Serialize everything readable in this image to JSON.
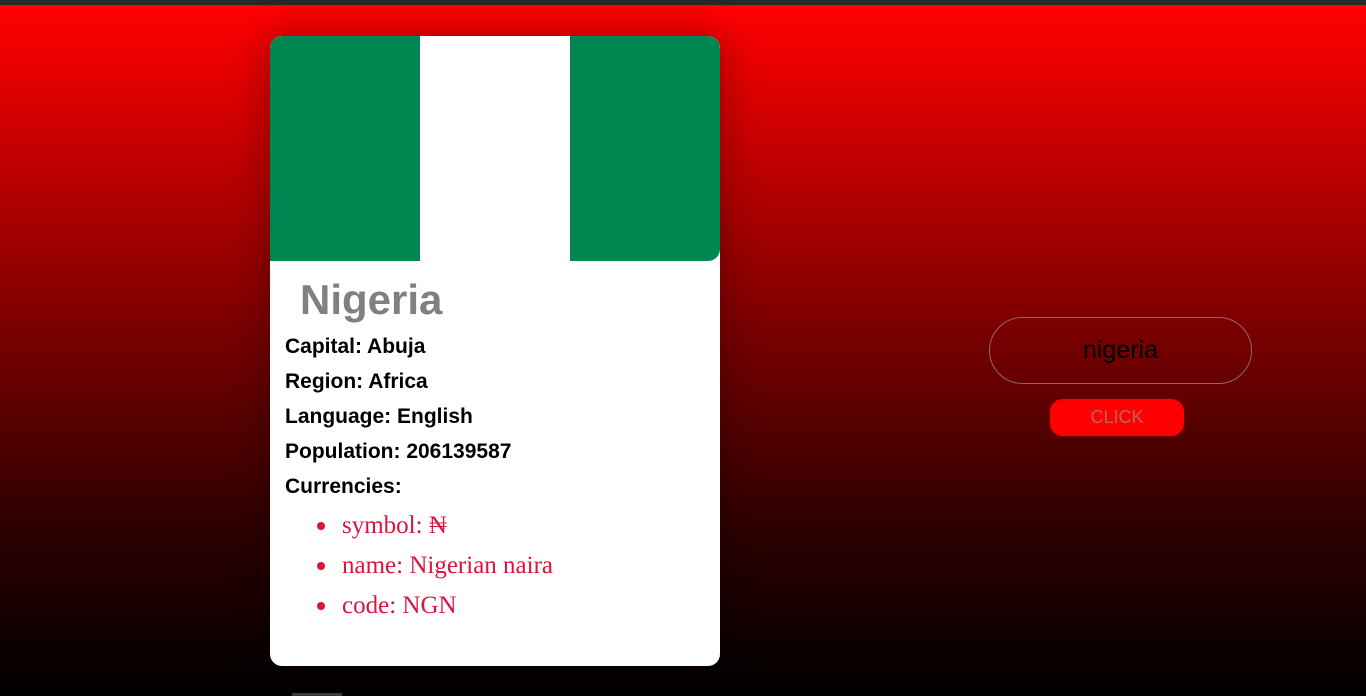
{
  "country": {
    "name": "Nigeria",
    "capital_line": "Capital: Abuja",
    "region_line": "Region: Africa",
    "language_line": "Language: English",
    "population_line": "Population: 206139587",
    "currencies_heading": "Currencies:",
    "currencies": [
      {
        "text": "symbol: ₦"
      },
      {
        "text": "name: Nigerian naira"
      },
      {
        "text": "code: NGN"
      }
    ]
  },
  "flag": {
    "colors": [
      "#008751",
      "#ffffff",
      "#008751"
    ]
  },
  "search": {
    "value": "nigeria",
    "button_label": "CLICK"
  },
  "theme": {
    "accent": "#ff0000",
    "currency_text": "#dc143c",
    "country_name_text": "#808080"
  }
}
